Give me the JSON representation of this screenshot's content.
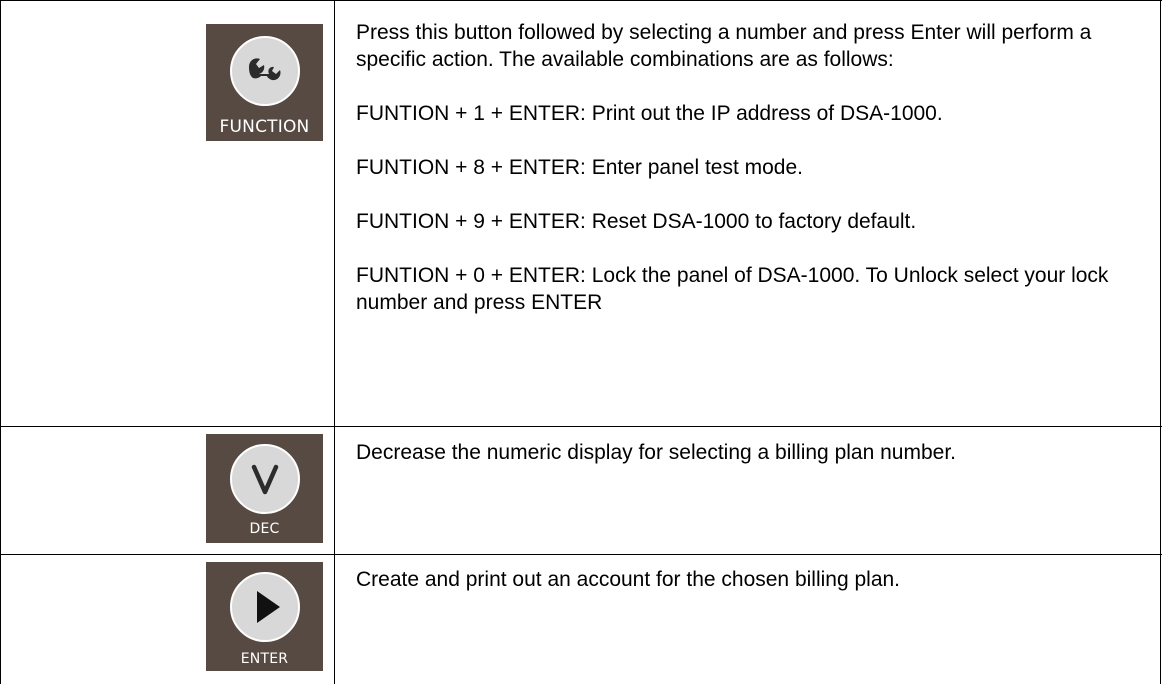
{
  "rows": [
    {
      "button": {
        "label": "FUNCTION",
        "icon": "wrench-icon"
      },
      "intro": "Press this button followed by selecting a number and press Enter will perform a specific action. The available combinations are as follows:",
      "combos": [
        "FUNTION + 1 + ENTER: Print out the IP address of DSA-1000.",
        "FUNTION + 8 + ENTER: Enter panel test mode.",
        "FUNTION + 9 + ENTER: Reset DSA-1000 to factory default.",
        "FUNTION + 0 + ENTER: Lock the panel of DSA-1000. To Unlock select your lock number and press ENTER"
      ]
    },
    {
      "button": {
        "label": "DEC",
        "icon": "chevron-down-icon"
      },
      "description": "Decrease the numeric display for selecting a billing plan number."
    },
    {
      "button": {
        "label": "ENTER",
        "icon": "play-icon"
      },
      "description": "Create and print out an account for the chosen billing plan."
    }
  ],
  "colors": {
    "tile": "#574a43",
    "circle": "#d8d8d8",
    "border": "#000000"
  }
}
